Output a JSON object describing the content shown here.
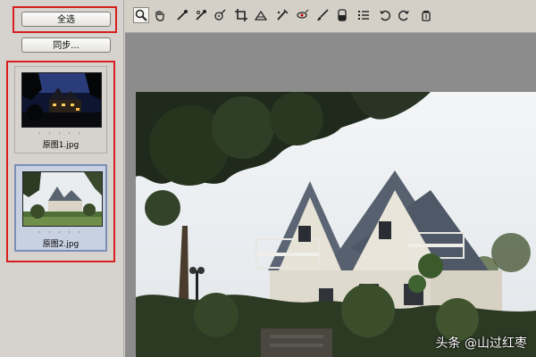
{
  "left_panel": {
    "select_all_label": "全选",
    "sync_label": "同步...",
    "thumbnails": [
      {
        "name": "原图1.jpg",
        "dots": "· · · · ·",
        "selected": false
      },
      {
        "name": "原图2.jpg",
        "dots": "· · · · ·",
        "selected": true
      }
    ]
  },
  "toolbar": {
    "tools": [
      "zoom-icon",
      "hand-icon",
      "eyedropper-icon",
      "color-sampler-icon",
      "target-adjust-icon",
      "crop-icon",
      "straighten-icon",
      "spot-removal-icon",
      "red-eye-icon",
      "brush-icon",
      "graduated-filter-icon",
      "list-icon",
      "rotate-left-icon",
      "rotate-right-icon",
      "trash-icon"
    ],
    "active_tool": "zoom-icon"
  },
  "colors": {
    "highlight_red": "#d81e1e",
    "panel_gray": "#d6d3ce",
    "canvas_gray": "#8c8c8c"
  },
  "watermark": "头条 @山过红枣"
}
